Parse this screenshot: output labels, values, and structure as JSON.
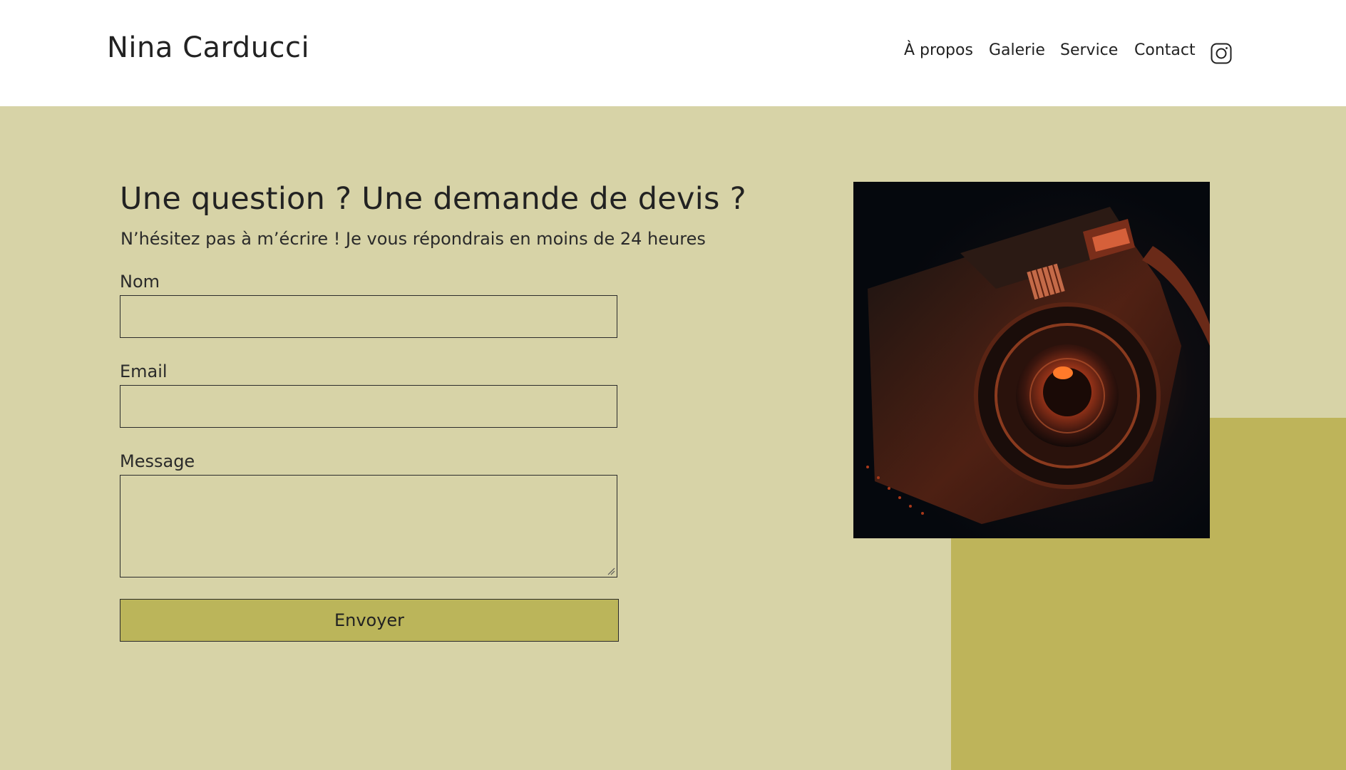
{
  "header": {
    "brand": "Nina Carducci",
    "nav": [
      {
        "label": "À propos"
      },
      {
        "label": "Galerie"
      },
      {
        "label": "Service"
      },
      {
        "label": "Contact"
      }
    ],
    "social_icon": "instagram-icon"
  },
  "contact": {
    "title": "Une question ? Une demande de devis ?",
    "subtitle": "N’hésitez pas à m’écrire ! Je vous répondrais en moins de 24 heures",
    "fields": {
      "name_label": "Nom",
      "email_label": "Email",
      "message_label": "Message"
    },
    "submit_label": "Envoyer"
  },
  "colors": {
    "section_bg": "#d7d3a7",
    "accent": "#beb45a",
    "button": "#bbb55a",
    "text": "#222222"
  }
}
